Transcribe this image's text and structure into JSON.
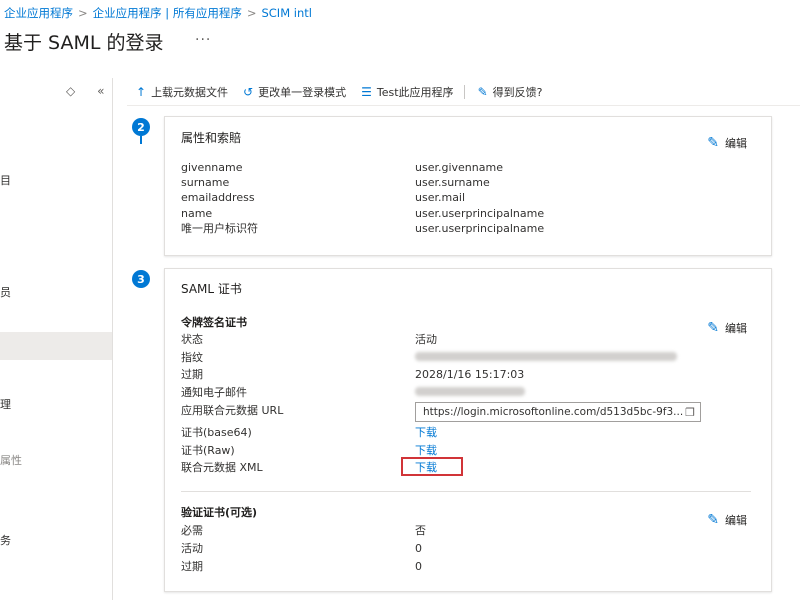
{
  "breadcrumb": {
    "items": [
      "企业应用程序",
      "企业应用程序 | 所有应用程序",
      "SCIM intl"
    ],
    "separator": ">"
  },
  "page": {
    "title": "基于 SAML 的登录",
    "more": "···"
  },
  "sidebar": {
    "controls": [
      "◇",
      "«"
    ],
    "items": [
      {
        "label": "目"
      },
      {
        "label": "员"
      },
      {
        "label": "理"
      },
      {
        "label": "属性"
      },
      {
        "label": "务"
      }
    ]
  },
  "toolbar": {
    "upload": {
      "label": "上载元数据文件",
      "icon": "upload-icon"
    },
    "change_mode": {
      "label": "更改单一登录模式",
      "icon": "undo-icon"
    },
    "test_app": {
      "label": "Test此应用程序",
      "icon": "list-icon"
    },
    "feedback": {
      "label": "得到反馈?",
      "icon": "feedback-icon"
    }
  },
  "steps": {
    "attributes": "2",
    "cert": "3"
  },
  "attributes_card": {
    "title": "属性和索賠",
    "edit": "编辑",
    "rows": [
      {
        "key": "givenname",
        "value": "user.givenname"
      },
      {
        "key": "surname",
        "value": "user.surname"
      },
      {
        "key": "emailaddress",
        "value": "user.mail"
      },
      {
        "key": "name",
        "value": "user.userprincipalname"
      },
      {
        "key": "唯一用户标识符",
        "value": "user.userprincipalname"
      }
    ]
  },
  "saml_card": {
    "title": "SAML 证书",
    "signing_section": {
      "title": "令牌签名证书",
      "edit": "编辑",
      "status_label": "状态",
      "status_value": "活动",
      "thumbprint_label": "指纹",
      "expiry_label": "过期",
      "expiry_value": "2028/1/16 15:17:03",
      "notify_label": "通知电子邮件",
      "metadata_url_label": "应用联合元数据 URL",
      "metadata_url_value": "https://login.microsoftonline.com/d513d5bc-9f3...",
      "cert_base64_label": "证书(base64)",
      "cert_base64_link": "下载",
      "cert_raw_label": "证书(Raw)",
      "cert_raw_link": "下载",
      "fed_xml_label": "联合元数据 XML",
      "fed_xml_link": "下载"
    },
    "verify_section": {
      "title": "验证证书(可选)",
      "edit": "编辑",
      "required_label": "必需",
      "required_value": "否",
      "active_label": "活动",
      "active_value": "0",
      "expired_label": "过期",
      "expired_value": "0"
    }
  },
  "colors": {
    "accent": "#0078d4",
    "highlight": "#d13438"
  }
}
